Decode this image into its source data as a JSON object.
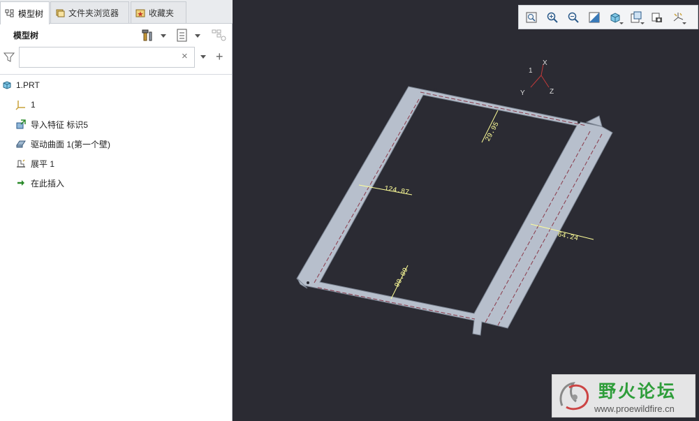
{
  "tabs": [
    {
      "label": "模型树"
    },
    {
      "label": "文件夹浏览器"
    },
    {
      "label": "收藏夹"
    }
  ],
  "panel": {
    "title": "模型树",
    "filter_placeholder": "",
    "clear_symbol": "×",
    "add_symbol": "+"
  },
  "tree": {
    "root": "1.PRT",
    "items": [
      {
        "label": "1",
        "icon": "csys-icon"
      },
      {
        "label": "导入特征 标识5",
        "icon": "import-feature-icon"
      },
      {
        "label": "驱动曲面 1(第一个壁)",
        "icon": "driving-surface-icon"
      },
      {
        "label": "展平 1",
        "icon": "flatten-icon"
      },
      {
        "label": "在此插入",
        "icon": "insert-arrow-icon"
      }
    ]
  },
  "viewport": {
    "triad": {
      "x": "X",
      "y": "Y",
      "z": "Z",
      "one": "1"
    },
    "dimensions": [
      "29.95",
      "124.87",
      "90.09",
      "64.24"
    ]
  },
  "watermark": {
    "title": "野火论坛",
    "url": "www.proewildfire.cn"
  },
  "colors": {
    "viewport_bg": "#2b2b33",
    "part_fill": "#b7bfcc",
    "dimension": "#ffff99",
    "bend_line": "#8a3a4a",
    "insert_arrow": "#2a8a2a",
    "brand_green": "#2e9d3a"
  }
}
